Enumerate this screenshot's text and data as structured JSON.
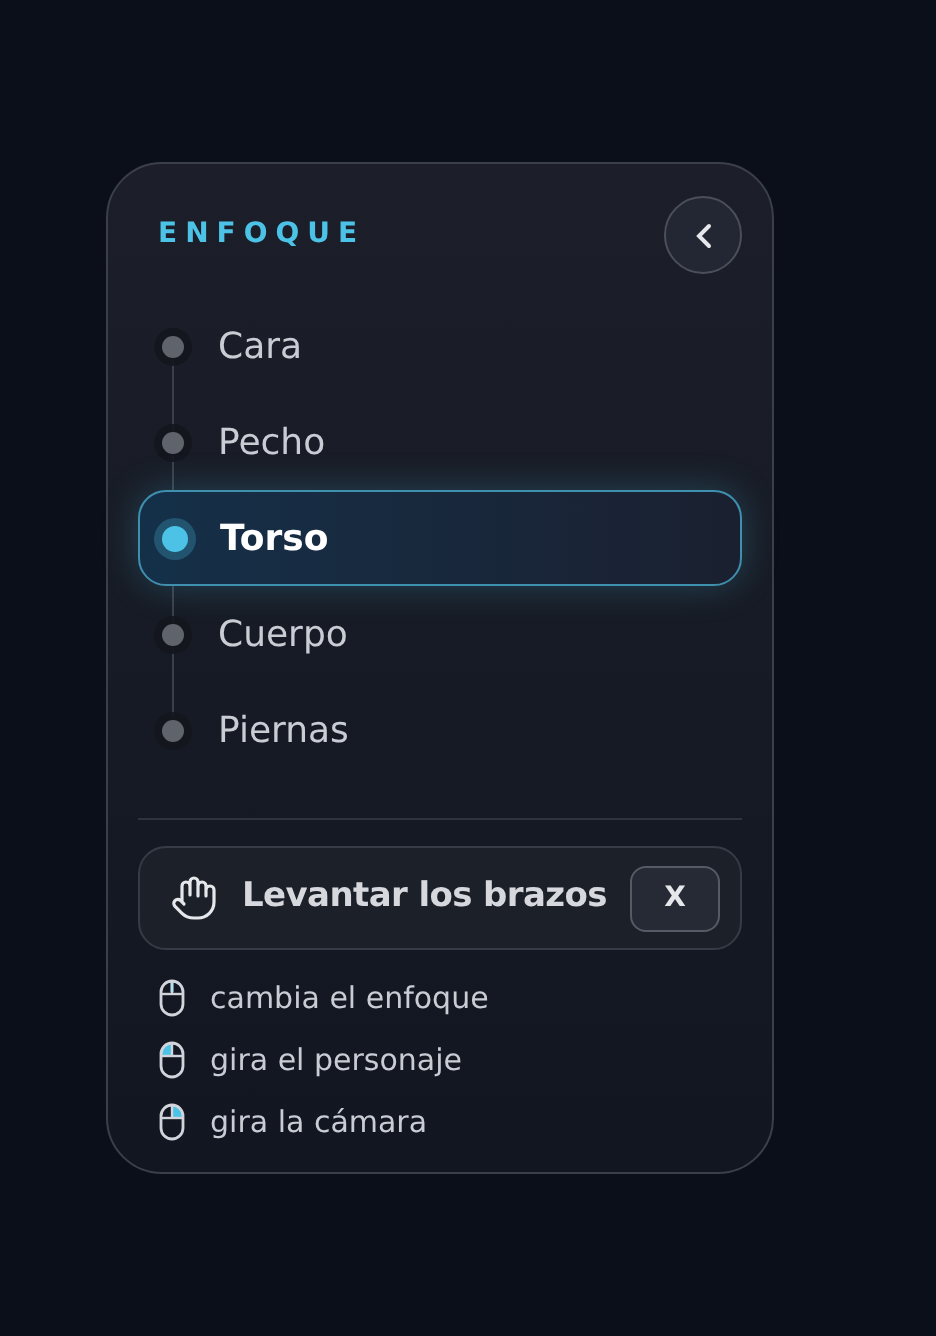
{
  "panel": {
    "title": "ENFOQUE"
  },
  "items": [
    {
      "label": "Cara",
      "selected": false
    },
    {
      "label": "Pecho",
      "selected": false
    },
    {
      "label": "Torso",
      "selected": true
    },
    {
      "label": "Cuerpo",
      "selected": false
    },
    {
      "label": "Piernas",
      "selected": false
    }
  ],
  "action": {
    "label": "Levantar los brazos",
    "key": "X"
  },
  "hints": [
    {
      "kind": "wheel",
      "text": "cambia el enfoque"
    },
    {
      "kind": "left",
      "text": "gira el personaje"
    },
    {
      "kind": "right",
      "text": "gira la cámara"
    }
  ]
}
